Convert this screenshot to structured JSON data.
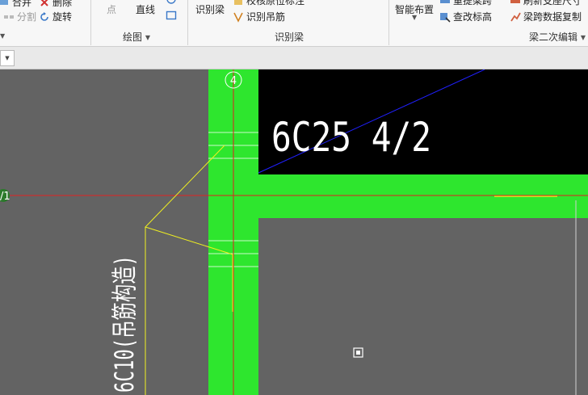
{
  "ribbon": {
    "items": {
      "close_left": "合并",
      "delete": "删除",
      "split": "分割",
      "rotate": "旋转",
      "point": "点",
      "line": "直线",
      "identify_beam": "识别梁",
      "identify_tag": "校核原位标注",
      "identify_hanger": "识别吊筋",
      "smart_layout": "智能布置",
      "reextract": "重提梁跨",
      "modify_elev": "查改标高",
      "beam_span_copy": "梁跨数据复制",
      "refresh_support": "刷新支座尺寸"
    },
    "groups": {
      "draw": "绘图",
      "identify_beam": "识别梁",
      "beam_edit": "梁二次编辑"
    }
  },
  "canvas": {
    "axis_label": "4",
    "left_axis_label": "/1",
    "rebar_text": "6C25 4/2",
    "stirrup_text": "6C10(吊筋构造)",
    "colors": {
      "background": "#636363",
      "beam_fill": "#2ee62e",
      "black_region": "#000000",
      "axis_red": "#e02020",
      "leader_yellow": "#f0f020",
      "dim_blue": "#2020ff",
      "text_white": "#ffffff"
    }
  }
}
